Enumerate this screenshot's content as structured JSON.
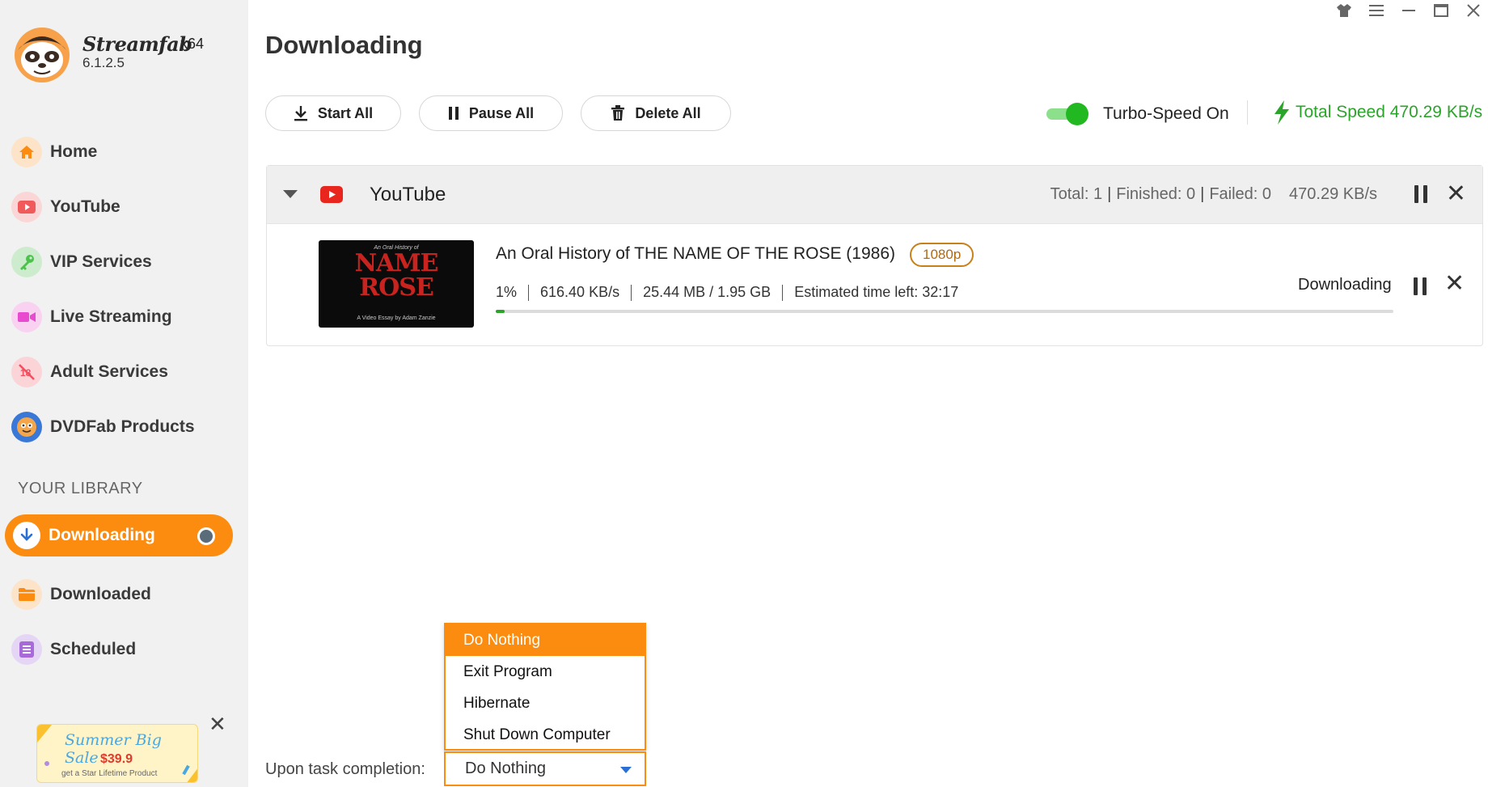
{
  "app": {
    "name": "Streamfab",
    "arch": "x64",
    "version": "6.1.2.5"
  },
  "nav": {
    "items": [
      {
        "label": "Home",
        "icon": "home-icon",
        "color": "#fb8c10"
      },
      {
        "label": "YouTube",
        "icon": "youtube-icon",
        "color": "#f15a5a"
      },
      {
        "label": "VIP Services",
        "icon": "key-icon",
        "color": "#4cc24c"
      },
      {
        "label": "Live Streaming",
        "icon": "camera-icon",
        "color": "#e84bd0"
      },
      {
        "label": "Adult Services",
        "icon": "no-adult-icon",
        "color": "#f05060"
      },
      {
        "label": "DVDFab Products",
        "icon": "dvdfab-icon",
        "color": "#3a78d8"
      }
    ]
  },
  "library": {
    "title": "YOUR LIBRARY",
    "items": [
      {
        "label": "Downloading",
        "icon": "download-icon",
        "active": true
      },
      {
        "label": "Downloaded",
        "icon": "folder-icon"
      },
      {
        "label": "Scheduled",
        "icon": "list-icon"
      }
    ]
  },
  "promo": {
    "title": "Summer Big Sale",
    "price": "$39.9",
    "sub": "get a Star Lifetime Product"
  },
  "main": {
    "title": "Downloading",
    "toolbar": {
      "start_all": "Start All",
      "pause_all": "Pause All",
      "delete_all": "Delete All"
    },
    "turbo_label": "Turbo-Speed On",
    "total_speed": "Total Speed 470.29 KB/s",
    "accent": "#fb8c10",
    "success": "#2aa52a"
  },
  "group": {
    "title": "YouTube",
    "total": "Total: 1",
    "finished": "Finished: 0",
    "failed": "Failed: 0",
    "speed": "470.29 KB/s",
    "task": {
      "thumb_top": "An Oral History of",
      "thumb_name": "NAME ROSE",
      "thumb_bottom": "A Video Essay by Adam Zanzie",
      "title": "An Oral History of THE NAME OF THE ROSE (1986)",
      "quality": "1080p",
      "percent": "1%",
      "progress_fraction": 0.01,
      "speed": "616.40 KB/s",
      "size": "25.44 MB / 1.95 GB",
      "eta": "Estimated time left: 32:17",
      "status": "Downloading"
    }
  },
  "completion": {
    "label": "Upon task completion:",
    "selected": "Do Nothing",
    "options": [
      "Do Nothing",
      "Exit Program",
      "Hibernate",
      "Shut Down Computer"
    ]
  }
}
